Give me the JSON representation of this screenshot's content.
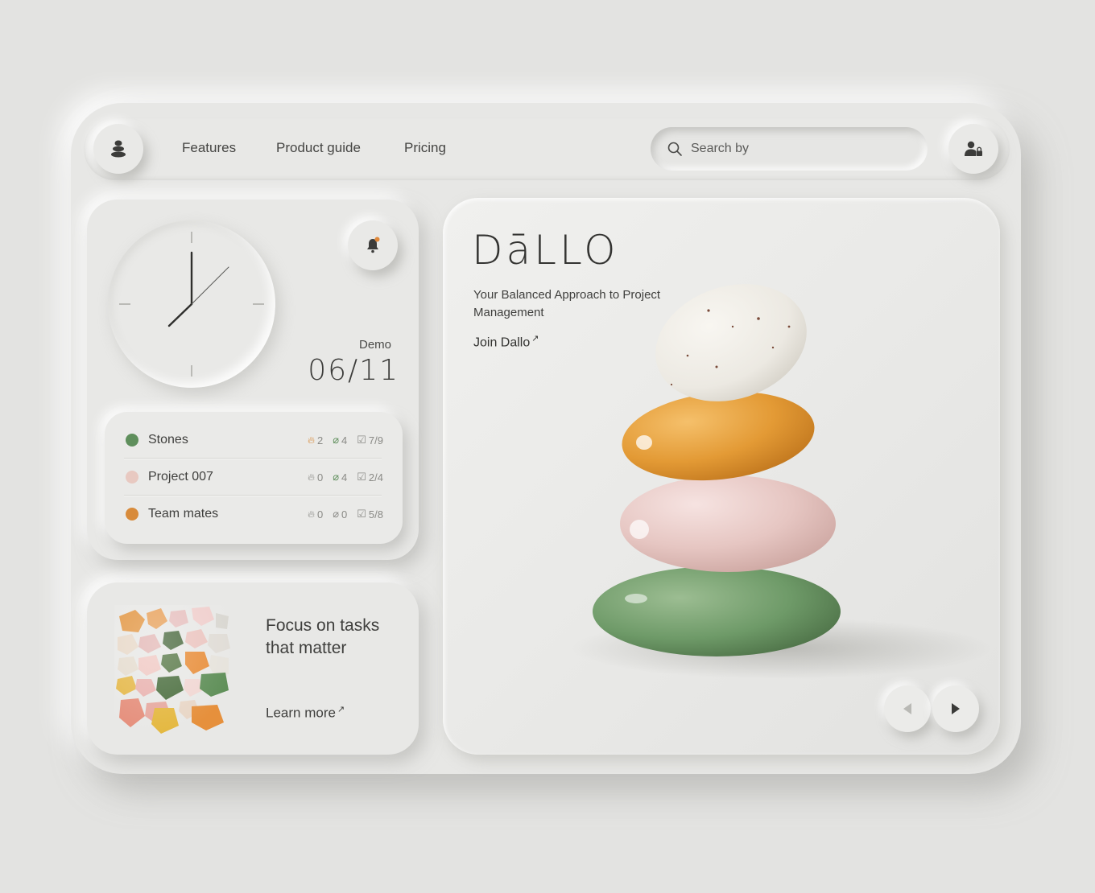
{
  "nav": {
    "links": [
      "Features",
      "Product guide",
      "Pricing"
    ],
    "search_placeholder": "Search by"
  },
  "clock": {
    "label": "Demo",
    "date": "06/11"
  },
  "projects": [
    {
      "name": "Stones",
      "color": "#5f8f5c",
      "fire": "2",
      "clips": "4",
      "tasks": "7/9"
    },
    {
      "name": "Project 007",
      "color": "#e8c9c1",
      "fire": "0",
      "clips": "4",
      "tasks": "2/4"
    },
    {
      "name": "Team mates",
      "color": "#d88b3b",
      "fire": "0",
      "clips": "0",
      "tasks": "5/8"
    }
  ],
  "focus": {
    "title": "Focus on tasks that matter",
    "learn_more": "Learn more"
  },
  "hero": {
    "brand": "DāLLO",
    "tagline": "Your Balanced Approach to Project Management",
    "cta": "Join Dallo"
  },
  "colors": {
    "background": "#e3e3e1",
    "stone_green": "#6e9a68",
    "stone_pink": "#e6c6c2",
    "stone_orange": "#e39a35",
    "stone_white": "#ece9e2",
    "notification_dot": "#e0883a"
  },
  "icons": {
    "logo": "stacked-stones-icon",
    "search": "search-icon",
    "user": "user-lock-icon",
    "bell": "bell-icon",
    "prev": "chevron-left-icon",
    "next": "chevron-right-icon"
  }
}
